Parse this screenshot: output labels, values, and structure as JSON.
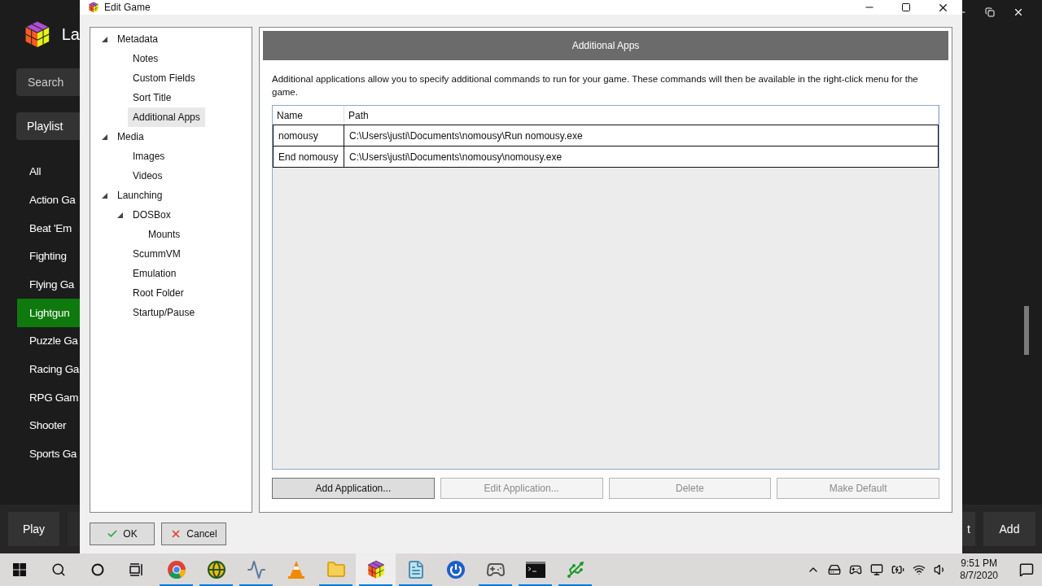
{
  "background_app": {
    "title": "La",
    "search": {
      "placeholder": "Search"
    },
    "playlist_button": "Playlist",
    "playlists": [
      {
        "label": "All",
        "selected": false
      },
      {
        "label": "Action Ga",
        "selected": false
      },
      {
        "label": "Beat 'Em",
        "selected": false
      },
      {
        "label": "Fighting",
        "selected": false
      },
      {
        "label": "Flying Ga",
        "selected": false
      },
      {
        "label": "Lightgun",
        "selected": true
      },
      {
        "label": "Puzzle Ga",
        "selected": false
      },
      {
        "label": "Racing Ga",
        "selected": false
      },
      {
        "label": "RPG Gam",
        "selected": false
      },
      {
        "label": "Shooter",
        "selected": false
      },
      {
        "label": "Sports Ga",
        "selected": false
      }
    ],
    "play_button": "Play",
    "right_buttons": [
      "t",
      "Add"
    ]
  },
  "dialog": {
    "title": "Edit Game",
    "tree": [
      {
        "label": "Metadata",
        "expanded": true,
        "selected": false,
        "children": [
          {
            "label": "Notes",
            "selected": false
          },
          {
            "label": "Custom Fields",
            "selected": false
          },
          {
            "label": "Sort Title",
            "selected": false
          },
          {
            "label": "Additional Apps",
            "selected": true
          }
        ]
      },
      {
        "label": "Media",
        "expanded": true,
        "selected": false,
        "children": [
          {
            "label": "Images",
            "selected": false
          },
          {
            "label": "Videos",
            "selected": false
          }
        ]
      },
      {
        "label": "Launching",
        "expanded": true,
        "selected": false,
        "children": [
          {
            "label": "DOSBox",
            "expanded": true,
            "selected": false,
            "children": [
              {
                "label": "Mounts",
                "selected": false
              }
            ]
          },
          {
            "label": "ScummVM",
            "selected": false
          },
          {
            "label": "Emulation",
            "selected": false
          },
          {
            "label": "Root Folder",
            "selected": false
          },
          {
            "label": "Startup/Pause",
            "selected": false
          }
        ]
      }
    ],
    "panel_title": "Additional Apps",
    "description": "Additional applications allow you to specify additional commands to run for your game.  These commands will then be available in the right-click menu for the game.",
    "table": {
      "columns": [
        "Name",
        "Path"
      ],
      "rows": [
        [
          "nomousy",
          "C:\\Users\\justi\\Documents\\nomousy\\Run nomousy.exe"
        ],
        [
          "End nomousy",
          "C:\\Users\\justi\\Documents\\nomousy\\nomousy.exe"
        ]
      ]
    },
    "actions": [
      {
        "label": "Add Application...",
        "disabled": false
      },
      {
        "label": "Edit Application...",
        "disabled": true
      },
      {
        "label": "Delete",
        "disabled": true
      },
      {
        "label": "Make Default",
        "disabled": true
      }
    ],
    "ok_button": "OK",
    "cancel_button": "Cancel"
  },
  "taskbar": {
    "apps": [
      {
        "kind": "chrome",
        "running": true,
        "active": false
      },
      {
        "kind": "globe",
        "running": true,
        "active": false
      },
      {
        "kind": "monitor",
        "running": true,
        "active": false
      },
      {
        "kind": "cone",
        "running": false,
        "active": false
      },
      {
        "kind": "folder",
        "running": true,
        "active": false
      },
      {
        "kind": "cube",
        "running": true,
        "active": true
      },
      {
        "kind": "notepad",
        "running": true,
        "active": false
      },
      {
        "kind": "power",
        "running": false,
        "active": false
      },
      {
        "kind": "joystick",
        "running": true,
        "active": false
      },
      {
        "kind": "terminal",
        "running": true,
        "active": false
      },
      {
        "kind": "usb",
        "running": true,
        "active": false
      }
    ],
    "time": "9:51 PM",
    "date": "8/7/2020"
  }
}
